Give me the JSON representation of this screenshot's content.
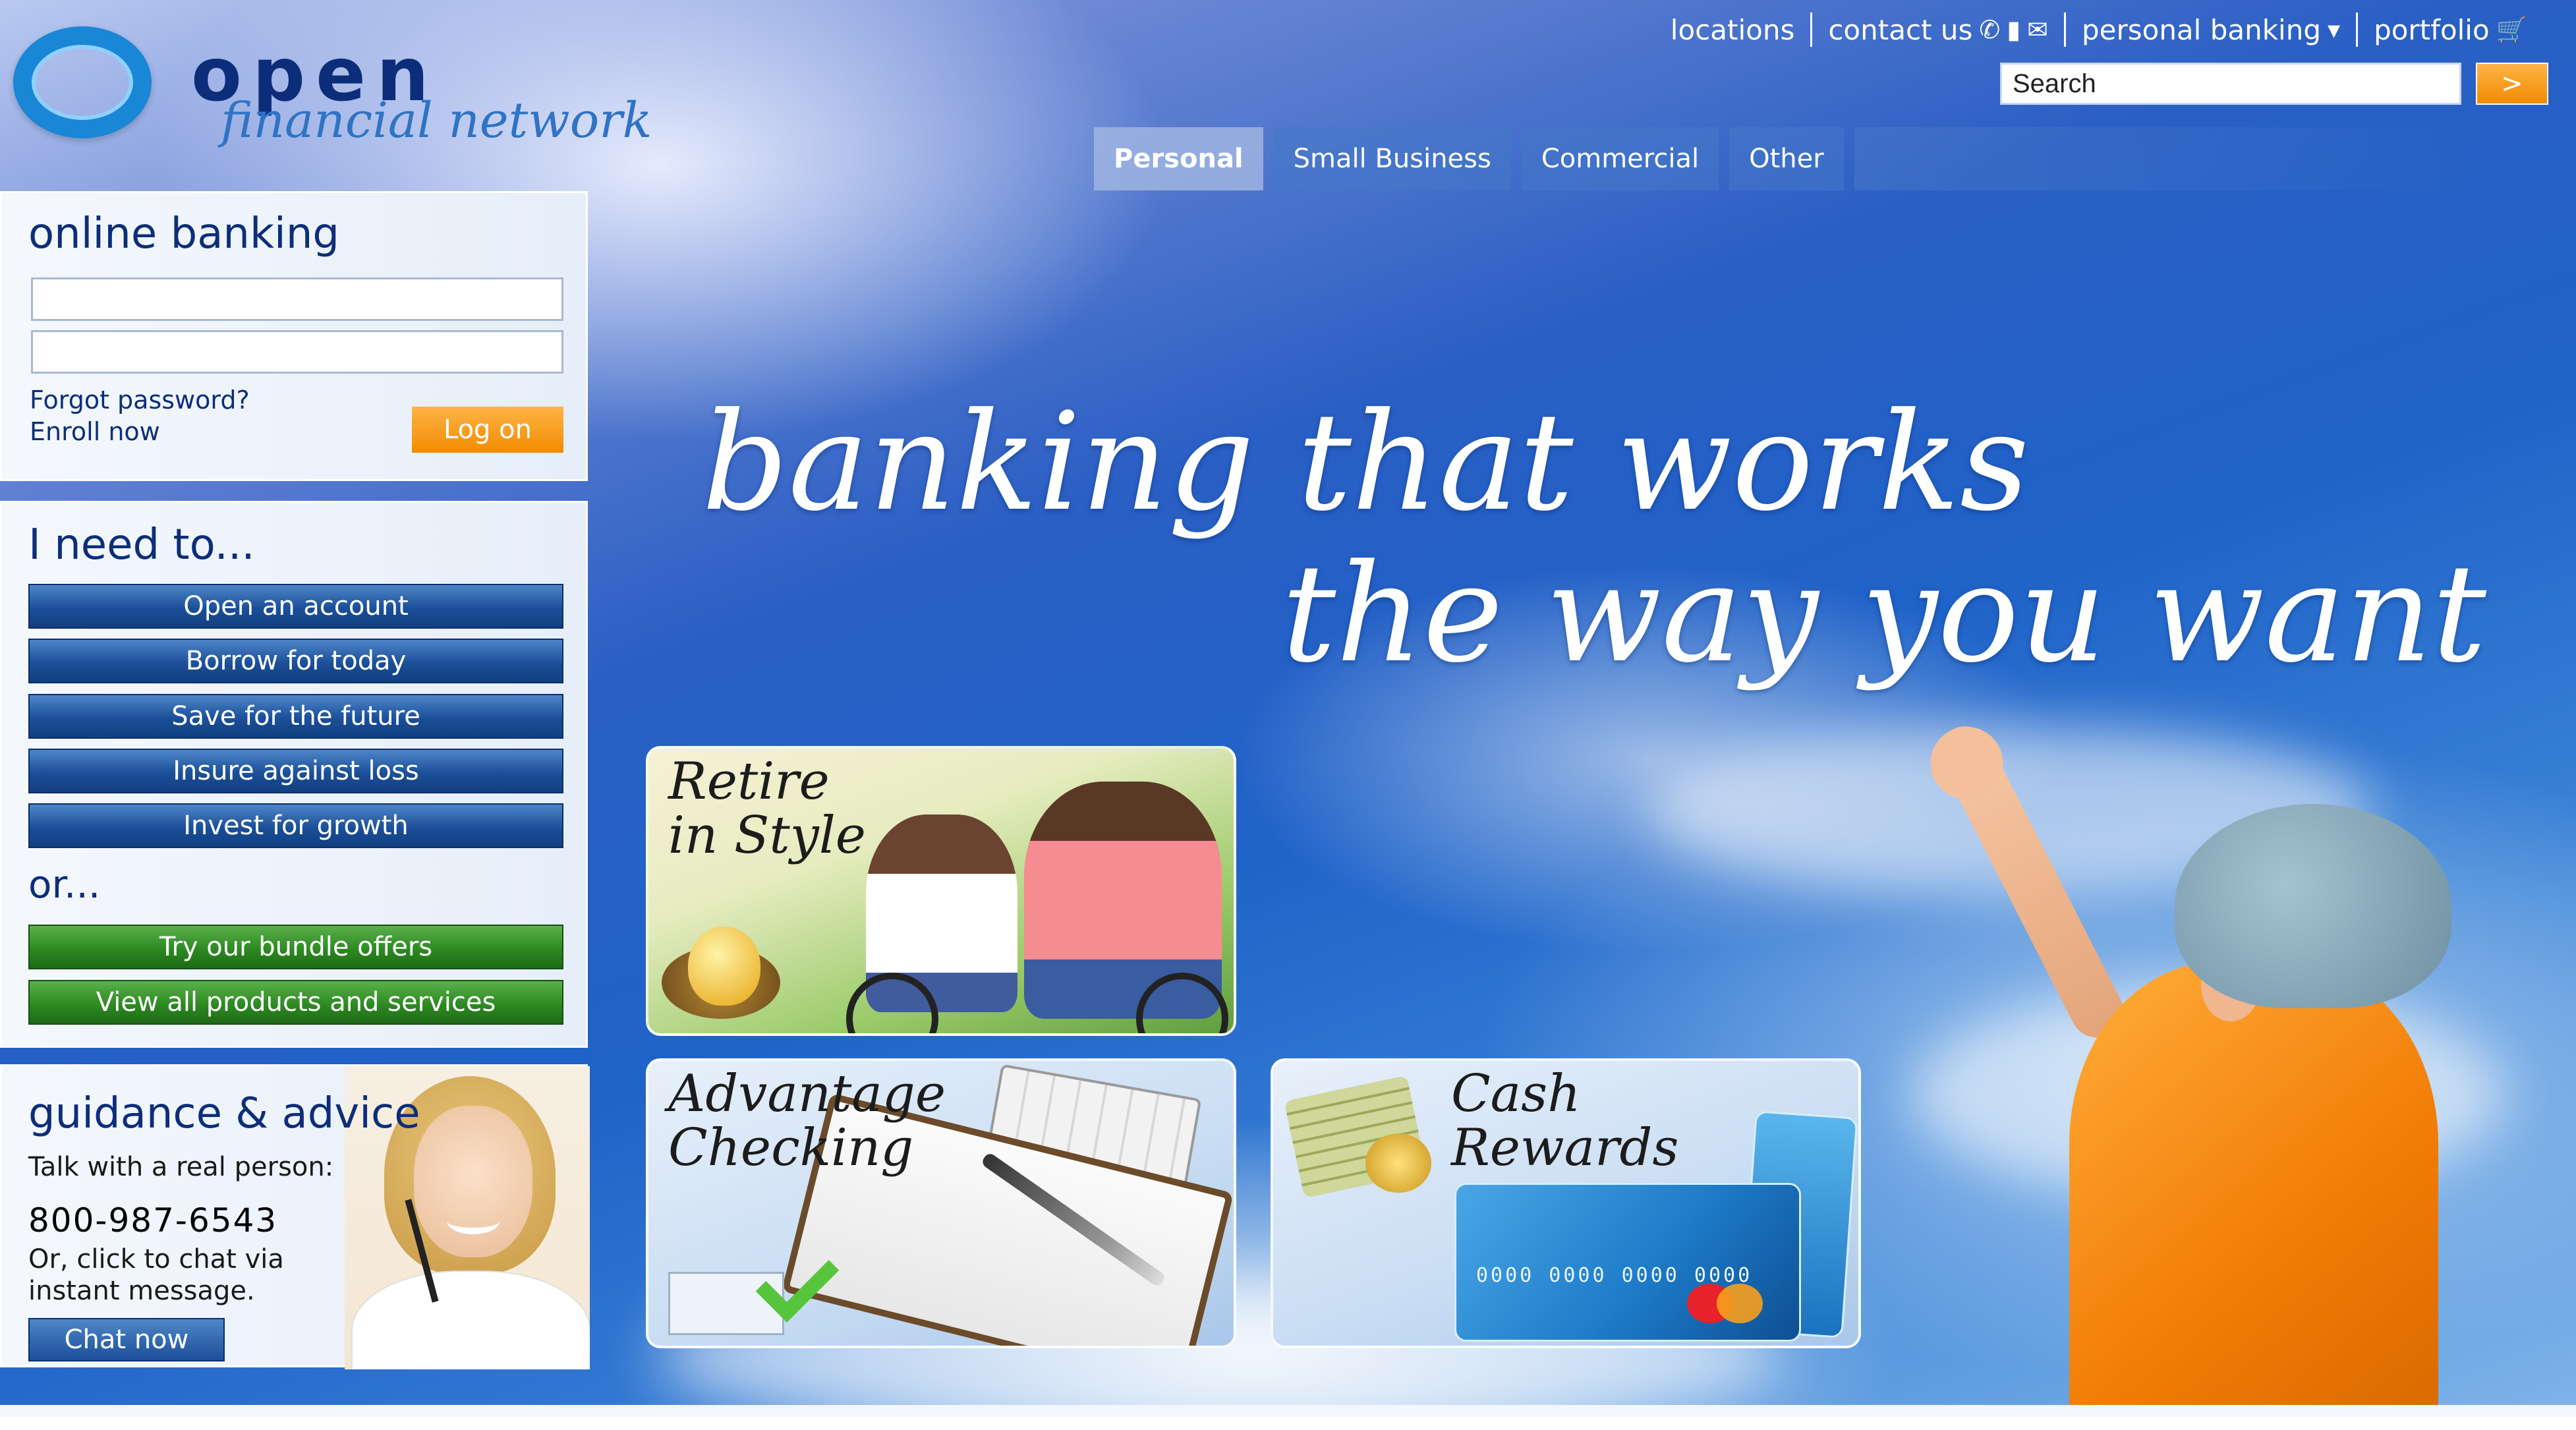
{
  "brand": {
    "name": "open",
    "tagline": "financial network",
    "ring_color": "#1a86d6"
  },
  "top_links": [
    {
      "label": "locations"
    },
    {
      "label": "contact us",
      "icons": [
        "phone-icon",
        "chat-bubble-icon",
        "envelope-icon"
      ]
    },
    {
      "label": "personal banking",
      "icons": [
        "caret-down-icon"
      ]
    },
    {
      "label": "portfolio",
      "icons": [
        "cart-icon"
      ]
    }
  ],
  "search": {
    "placeholder": "Search",
    "button_label": ">"
  },
  "nav": {
    "tabs": [
      {
        "label": "Personal",
        "active": true
      },
      {
        "label": "Small Business"
      },
      {
        "label": "Commercial"
      },
      {
        "label": "Other"
      }
    ]
  },
  "login": {
    "title": "online banking",
    "forgot_label": "Forgot password?",
    "enroll_label": "Enroll now",
    "logon_label": "Log on"
  },
  "needs": {
    "title": "I need to...",
    "actions": [
      "Open an account",
      "Borrow for today",
      "Save for the future",
      "Insure against loss",
      "Invest for growth"
    ],
    "or_label": "or...",
    "extra_actions": [
      "Try our bundle offers",
      "View all products and services"
    ]
  },
  "guidance": {
    "title": "guidance & advice",
    "talk_label": "Talk with a real person:",
    "phone": "800-987-6543",
    "chat_text_1": "Or, click to chat via",
    "chat_text_2": "instant message.",
    "chat_button": "Chat now"
  },
  "hero": {
    "line1": "banking that works",
    "line2": "the way you want"
  },
  "promos": {
    "retire": {
      "line1": "Retire",
      "line2": "in Style"
    },
    "checking": {
      "line1": "Advantage",
      "line2": "Checking"
    },
    "cash": {
      "line1": "Cash",
      "line2": "Rewards",
      "card_number": "0000 0000 0000 0000"
    }
  },
  "colors": {
    "accent_orange": "#f08c00",
    "nav_blue": "#1b4f99",
    "green": "#2e8a22"
  }
}
